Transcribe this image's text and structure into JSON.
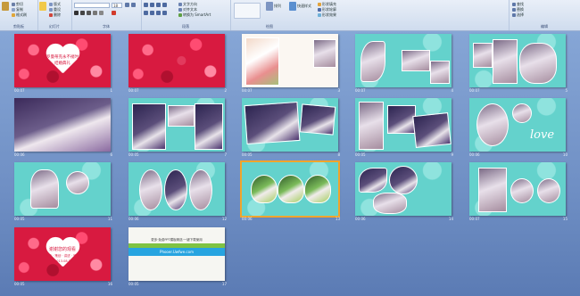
{
  "ribbon": {
    "groups": [
      {
        "label": "剪贴板"
      },
      {
        "label": "幻灯片"
      },
      {
        "label": "字体"
      },
      {
        "label": "段落"
      },
      {
        "label": "绘图"
      },
      {
        "label": "编辑"
      }
    ],
    "clipboard": {
      "paste": "粘贴",
      "cut": "剪切",
      "copy": "复制",
      "format_painter": "格式刷"
    },
    "slides": {
      "new_slide": "新建幻灯片",
      "layout": "版式",
      "reset": "重设",
      "delete": "删除"
    },
    "font": {
      "font_name": "",
      "font_size": "18"
    },
    "paragraph": {
      "text_direction": "文字方向",
      "align_text": "对齐文本",
      "smartart": "转换为 SmartArt"
    },
    "drawing": {
      "arrange": "排列",
      "quick_styles": "快速样式",
      "shape_fill": "形状填充",
      "shape_outline": "形状轮廓",
      "shape_effects": "形状效果"
    },
    "editing": {
      "find": "查找",
      "replace": "替换",
      "select": "选择"
    }
  },
  "slides": [
    {
      "number": "1",
      "time": "00:07",
      "title": "罗曼蒂克永不褪时",
      "subtitle": "结婚典礼"
    },
    {
      "number": "2",
      "time": "00:07"
    },
    {
      "number": "3",
      "time": "00:07"
    },
    {
      "number": "4",
      "time": "00:07"
    },
    {
      "number": "5",
      "time": "00:07"
    },
    {
      "number": "6",
      "time": "00:06"
    },
    {
      "number": "7",
      "time": "00:05"
    },
    {
      "number": "8",
      "time": "00:05"
    },
    {
      "number": "9",
      "time": "00:05"
    },
    {
      "number": "10",
      "time": "00:06",
      "caption": "love"
    },
    {
      "number": "11",
      "time": "00:05"
    },
    {
      "number": "12",
      "time": "00:06"
    },
    {
      "number": "13",
      "time": "00:06"
    },
    {
      "number": "14",
      "time": "00:06"
    },
    {
      "number": "15",
      "time": "00:07"
    },
    {
      "number": "16",
      "time": "00:05",
      "title": "谢谢您的观看",
      "subtitle": "执行 · 策划 · 讲述 · 完成",
      "date": "2013.08.1"
    },
    {
      "number": "17",
      "time": "00:05",
      "line1": "更多·免费PPT模板精选·一键下载使用",
      "line2": "Phooer.Uwfwe.com"
    }
  ],
  "selected_slide": "13",
  "colors": {
    "rose": "#d81a40",
    "teal": "#64d2cc",
    "selection": "#f0a52c",
    "background": "#6f8fc4"
  }
}
